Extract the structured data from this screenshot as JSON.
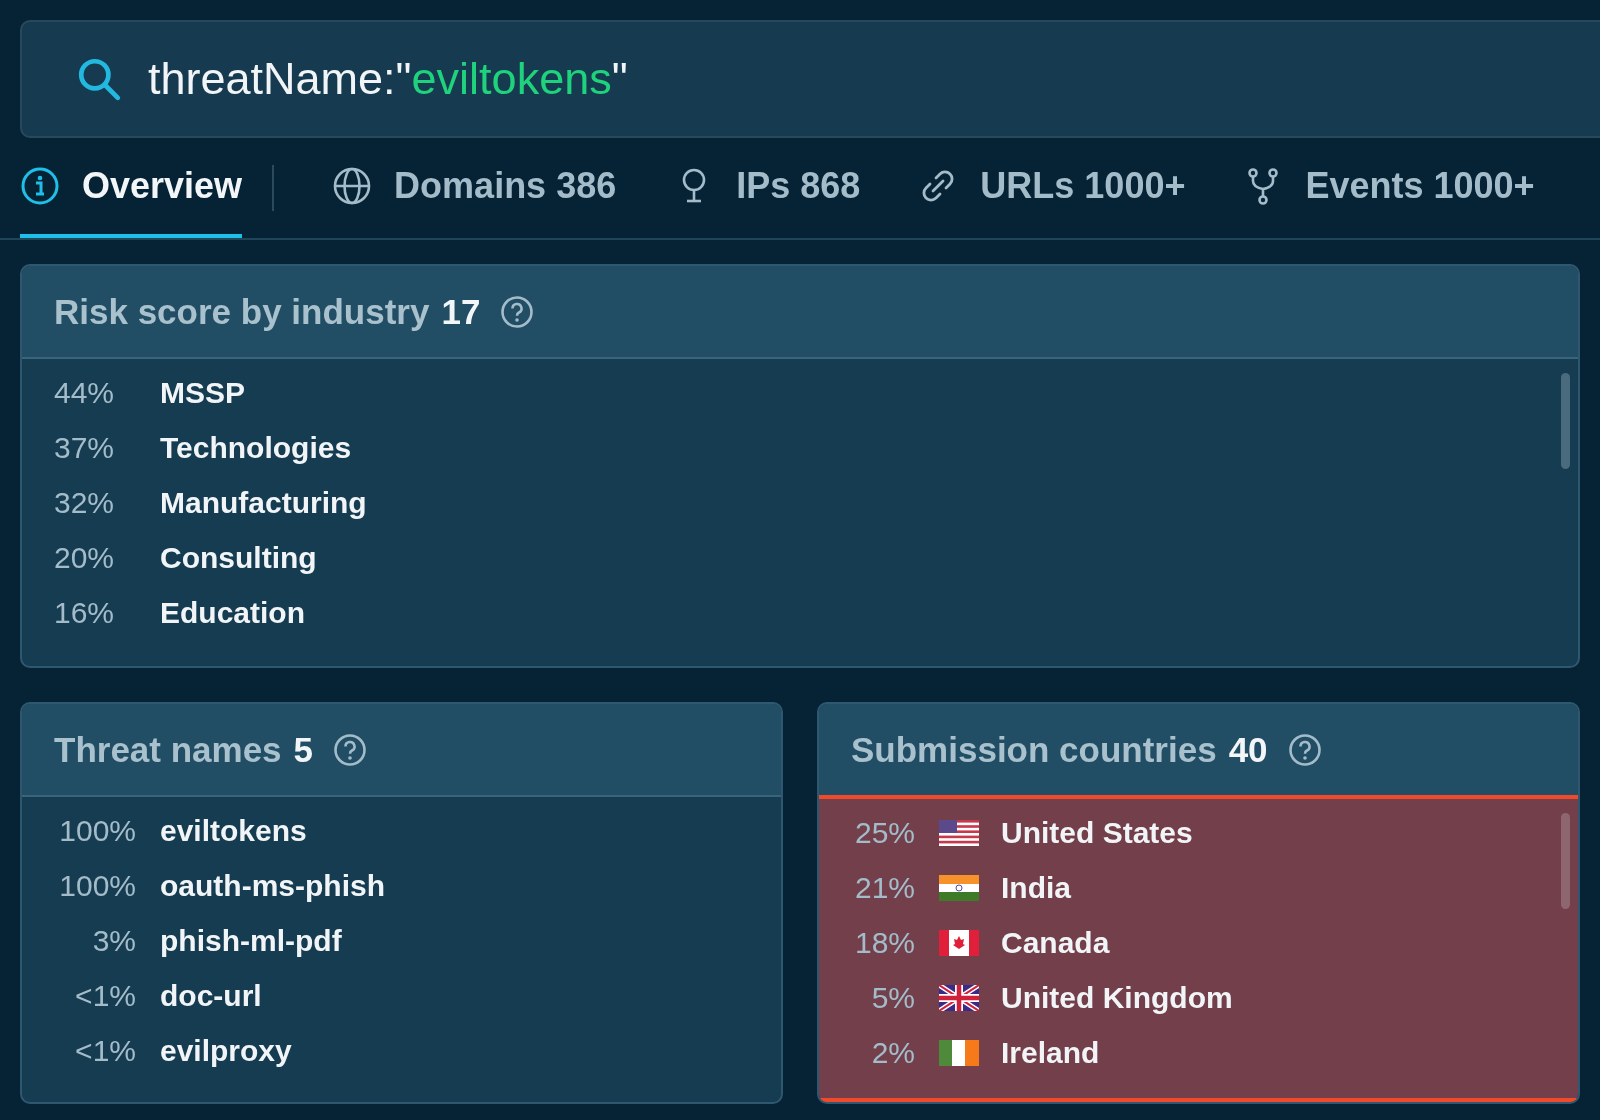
{
  "search": {
    "parts": [
      {
        "kind": "key",
        "text": "threatName:\""
      },
      {
        "kind": "value",
        "text": "eviltokens"
      },
      {
        "kind": "key",
        "text": "\""
      }
    ]
  },
  "tabs": [
    {
      "kind": "info",
      "label": "Overview",
      "selected": true
    },
    {
      "kind": "globe",
      "label": "Domains 386",
      "selected": false
    },
    {
      "kind": "pin",
      "label": "IPs 868",
      "selected": false
    },
    {
      "kind": "link",
      "label": "URLs 1000+",
      "selected": false
    },
    {
      "kind": "fork",
      "label": "Events 1000+",
      "selected": false
    }
  ],
  "risk_panel": {
    "title": "Risk score by industry",
    "count": "17",
    "rows": [
      {
        "percent": "44%",
        "label": "MSSP"
      },
      {
        "percent": "37%",
        "label": "Technologies"
      },
      {
        "percent": "32%",
        "label": "Manufacturing"
      },
      {
        "percent": "20%",
        "label": "Consulting"
      },
      {
        "percent": "16%",
        "label": "Education"
      }
    ]
  },
  "threat_panel": {
    "title": "Threat names",
    "count": "5",
    "rows": [
      {
        "percent": "100%",
        "label": "eviltokens"
      },
      {
        "percent": "100%",
        "label": "oauth-ms-phish"
      },
      {
        "percent": "3%",
        "label": "phish-ml-pdf"
      },
      {
        "percent": "<1%",
        "label": "doc-url"
      },
      {
        "percent": "<1%",
        "label": "evilproxy"
      }
    ]
  },
  "countries_panel": {
    "title": "Submission countries",
    "count": "40",
    "highlighted": true,
    "rows": [
      {
        "percent": "25%",
        "kind": "us",
        "label": "United States"
      },
      {
        "percent": "21%",
        "kind": "in",
        "label": "India"
      },
      {
        "percent": "18%",
        "kind": "ca",
        "label": "Canada"
      },
      {
        "percent": "5%",
        "kind": "gb",
        "label": "United Kingdom"
      },
      {
        "percent": "2%",
        "kind": "ie",
        "label": "Ireland"
      }
    ]
  }
}
